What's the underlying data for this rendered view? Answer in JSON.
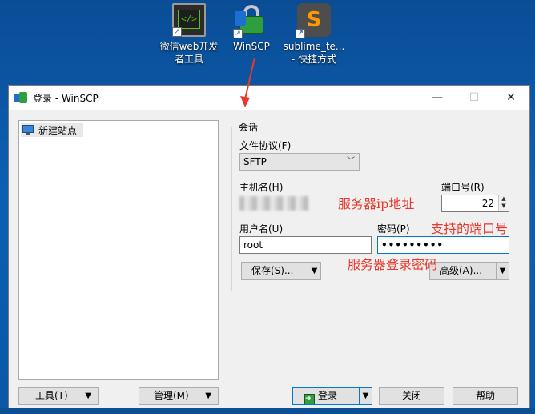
{
  "desktop": {
    "icons": [
      {
        "label": "微信web开发者工具",
        "icon": "wechat-devtools-icon"
      },
      {
        "label": "WinSCP",
        "icon": "winscp-icon"
      },
      {
        "label": "sublime_te... - 快捷方式",
        "icon": "sublime-text-icon"
      }
    ]
  },
  "window": {
    "title": "登录 - WinSCP",
    "controls": {
      "minimize": "—",
      "maximize": "☐",
      "close": "✕"
    },
    "sites": {
      "items": [
        {
          "label": "新建站点"
        }
      ]
    },
    "session": {
      "group_label": "会话",
      "protocol_label": "文件协议(F)",
      "protocol_value": "SFTP",
      "host_label": "主机名(H)",
      "host_value": "",
      "port_label": "端口号(R)",
      "port_value": "22",
      "user_label": "用户名(U)",
      "user_value": "root",
      "password_label": "密码(P)",
      "password_value": "•••••••••",
      "save_button": "保存(S)...",
      "advanced_button": "高级(A)..."
    },
    "bottom": {
      "tools_button": "工具(T)",
      "manage_button": "管理(M)",
      "login_button": "登录",
      "close_button": "关闭",
      "help_button": "帮助"
    }
  },
  "annotations": {
    "host": "服务器ip地址",
    "port": "支持的端口号",
    "password": "服务器登录密码"
  },
  "colors": {
    "annotation": "#e8372c",
    "desktop": "#0e5fb0",
    "focus": "#0078d7"
  }
}
